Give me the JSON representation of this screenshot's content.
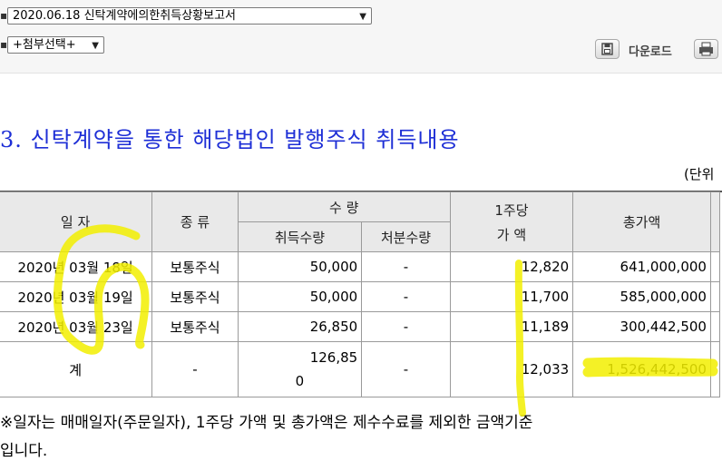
{
  "toolbar": {
    "report_select": "2020.06.18 신탁계약에의한취득상황보고서",
    "attach_select": "+첨부선택+",
    "download_label": "다운로드",
    "icons": [
      "save-icon",
      "print-icon"
    ]
  },
  "document": {
    "title": "3. 신탁계약을 통한 해당법인 발행주식 취득내용",
    "unit": "(단위",
    "table": {
      "headers": {
        "date": "일 자",
        "type": "종 류",
        "quantity": "수 량",
        "acquired_qty": "취득수량",
        "disposed_qty": "처분수량",
        "per_share_line1": "1주당",
        "per_share_line2": "가 액",
        "total": "총가액"
      },
      "rows": [
        {
          "date": "2020년 03월 18일",
          "type": "보통주식",
          "acquired": "50,000",
          "disposed": "-",
          "price": "12,820",
          "total": "641,000,000"
        },
        {
          "date": "2020년 03월 19일",
          "type": "보통주식",
          "acquired": "50,000",
          "disposed": "-",
          "price": "11,700",
          "total": "585,000,000"
        },
        {
          "date": "2020년 03월 23일",
          "type": "보통주식",
          "acquired": "26,850",
          "disposed": "-",
          "price": "11,189",
          "total": "300,442,500"
        }
      ],
      "sum": {
        "label": "계",
        "type": "-",
        "acquired_line1": "126,85",
        "acquired_line2": "0",
        "disposed": "-",
        "price": "12,033",
        "total": "1,526,442,500"
      }
    },
    "note_line1": "※일자는 매매일자(주문일자), 1주당 가액 및 총가액은 제수수료를 제외한 금액기준",
    "note_line2": "입니다."
  },
  "annotation_color": "#f2ef00"
}
